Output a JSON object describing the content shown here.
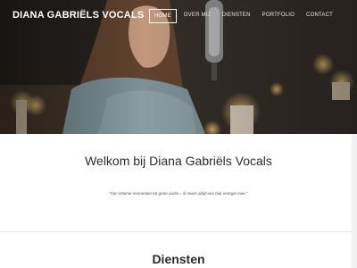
{
  "site": {
    "brand": "DIANA GABRIËLS VOCALS"
  },
  "nav": {
    "items": [
      {
        "label": "HOME",
        "active": true
      },
      {
        "label": "OVER MIJ",
        "active": false
      },
      {
        "label": "DIENSTEN",
        "active": false
      },
      {
        "label": "PORTFOLIO",
        "active": false
      },
      {
        "label": "CONTACT",
        "active": false
      }
    ]
  },
  "intro": {
    "title": "Welkom bij Diana Gabriëls Vocals",
    "quote": "“Van intieme momenten tot grote podia – ik neem altijd een bak energie mee.”"
  },
  "services": {
    "title": "Diensten"
  },
  "colors": {
    "hero_dark": "#2a2520",
    "text": "#2b2b2b",
    "candle": "#f3b24a"
  }
}
